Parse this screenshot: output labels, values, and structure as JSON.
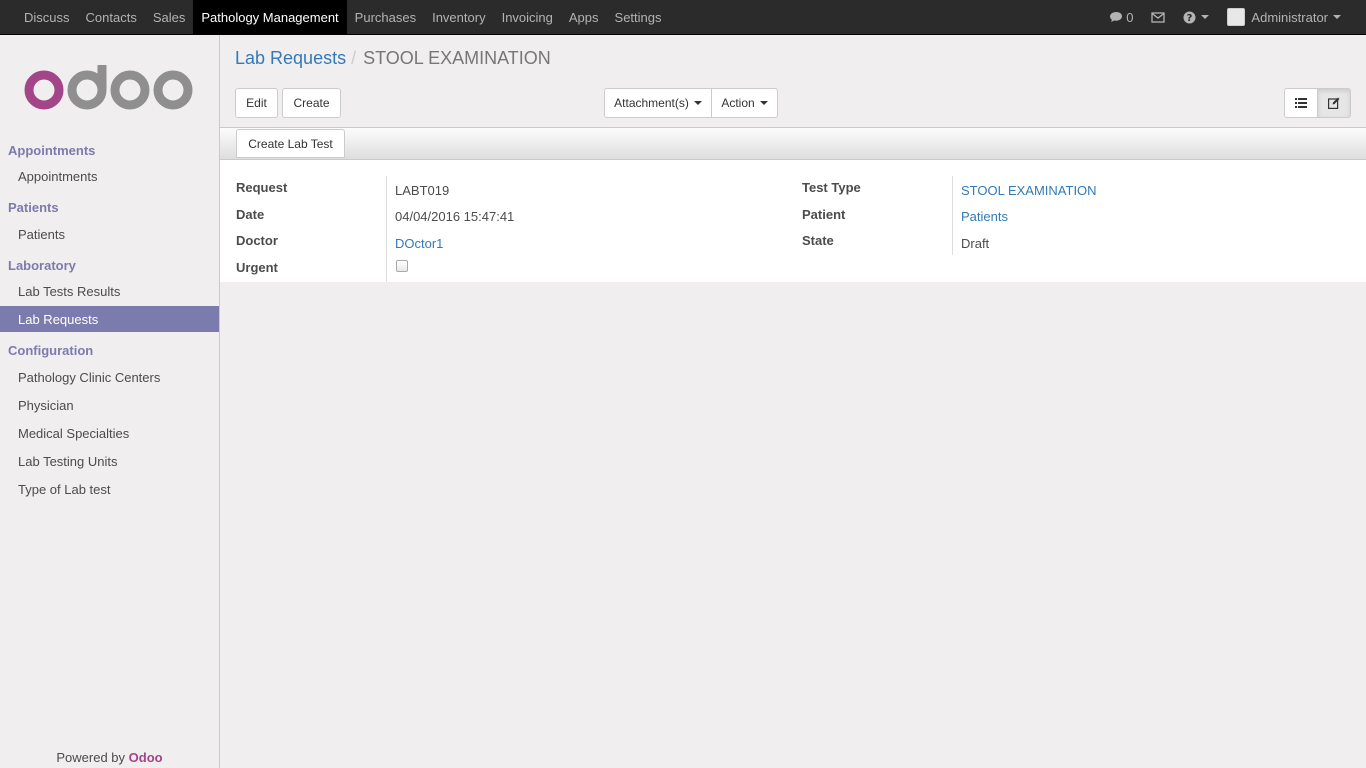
{
  "topbar": {
    "menu": [
      {
        "label": "Discuss",
        "active": false
      },
      {
        "label": "Contacts",
        "active": false
      },
      {
        "label": "Sales",
        "active": false
      },
      {
        "label": "Pathology Management",
        "active": true
      },
      {
        "label": "Purchases",
        "active": false
      },
      {
        "label": "Inventory",
        "active": false
      },
      {
        "label": "Invoicing",
        "active": false
      },
      {
        "label": "Apps",
        "active": false
      },
      {
        "label": "Settings",
        "active": false
      }
    ],
    "chat_count": "0",
    "user_name": "Administrator"
  },
  "sidebar": {
    "sections": [
      {
        "title": "Appointments",
        "items": [
          "Appointments"
        ]
      },
      {
        "title": "Patients",
        "items": [
          "Patients"
        ]
      },
      {
        "title": "Laboratory",
        "items": [
          "Lab Tests Results",
          "Lab Requests"
        ]
      },
      {
        "title": "Configuration",
        "items": [
          "Pathology Clinic Centers",
          "Physician",
          "Medical Specialties",
          "Lab Testing Units",
          "Type of Lab test"
        ]
      }
    ],
    "active_item": "Lab Requests",
    "powered_by": "Powered by",
    "powered_brand": "Odoo"
  },
  "breadcrumb": {
    "parent": "Lab Requests",
    "separator": "/",
    "current": "STOOL EXAMINATION"
  },
  "buttons": {
    "edit": "Edit",
    "create": "Create",
    "attachments": "Attachment(s)",
    "action": "Action",
    "create_lab_test": "Create Lab Test"
  },
  "form": {
    "left": [
      {
        "label": "Request",
        "value": "LABT019",
        "type": "text"
      },
      {
        "label": "Date",
        "value": "04/04/2016 15:47:41",
        "type": "text"
      },
      {
        "label": "Doctor",
        "value": "DOctor1",
        "type": "link"
      },
      {
        "label": "Urgent",
        "value": "",
        "type": "checkbox",
        "checked": false
      }
    ],
    "right": [
      {
        "label": "Test Type",
        "value": "STOOL EXAMINATION",
        "type": "link"
      },
      {
        "label": "Patient",
        "value": "Patients",
        "type": "link"
      },
      {
        "label": "State",
        "value": "Draft",
        "type": "text"
      }
    ]
  },
  "colors": {
    "accent": "#7c7bad",
    "link": "#337ab7",
    "brand": "#a24689",
    "topbar": "#2b2b2b"
  }
}
